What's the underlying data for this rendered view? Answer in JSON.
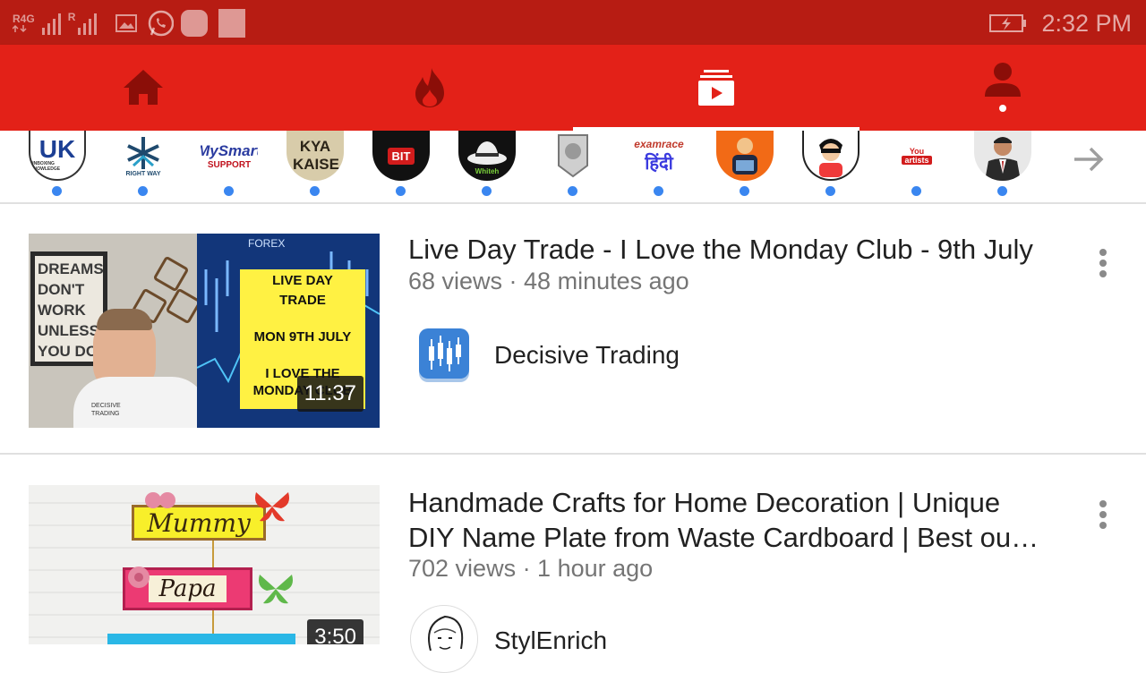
{
  "status_bar": {
    "network": "R4G",
    "roaming": "R",
    "time": "2:32 PM",
    "icons": [
      "signal-icon",
      "gallery-icon",
      "whatsapp-icon",
      "app-icon",
      "app-icon",
      "battery-charging-icon"
    ]
  },
  "nav": {
    "tabs": [
      {
        "icon": "home-icon",
        "name": "home"
      },
      {
        "icon": "trending-icon",
        "name": "trending"
      },
      {
        "icon": "subscriptions-icon",
        "name": "subscriptions",
        "active": true
      },
      {
        "icon": "account-icon",
        "name": "account"
      }
    ],
    "colors": {
      "bar": "#e32118",
      "status": "#b71c13",
      "icon": "#8b0e08"
    }
  },
  "subscriptions": [
    {
      "label": "UK",
      "sub": "UNBOXING KNOWLEDGE"
    },
    {
      "label": "RIGHT WAY"
    },
    {
      "label": "MySmart",
      "sub": "SUPPORT"
    },
    {
      "label": "KYA KAISE"
    },
    {
      "label": "BIT"
    },
    {
      "label": "Whiteh"
    },
    {
      "label": ""
    },
    {
      "label": "examrace",
      "sub": "हिंदी"
    },
    {
      "label": ""
    },
    {
      "label": ""
    },
    {
      "label": "You",
      "sub": "artists"
    },
    {
      "label": ""
    }
  ],
  "videos": [
    {
      "title": "Live Day Trade - I Love the Monday Club - 9th July",
      "meta": "68 views · 48 minutes ago",
      "channel": "Decisive Trading",
      "duration": "11:37",
      "thumb_text": {
        "poster": "DREAMS DON'T WORK UNLESS YOU DO",
        "forex": "FOREX",
        "l1": "LIVE DAY",
        "l2": "TRADE",
        "l3": "MON 9TH JULY",
        "l4": "I LOVE THE",
        "l5": "MONDAY CLUB",
        "shirt": "DECISIVE TRADING"
      }
    },
    {
      "title": "Handmade Crafts for Home Decoration | Unique DIY Name Plate from Waste Cardboard | Best ou…",
      "meta": "702 views · 1 hour ago",
      "channel": "StylEnrich",
      "duration": "3:50",
      "thumb_text": {
        "mummy": "Mummy",
        "papa": "Papa"
      }
    }
  ]
}
